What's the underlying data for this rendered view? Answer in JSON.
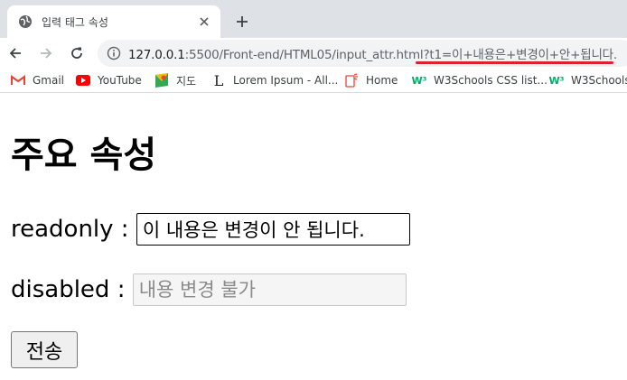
{
  "browser": {
    "tab": {
      "title": "입력 태그 속성"
    },
    "toolbar": {
      "url_host": "127.0.0.1",
      "url_path": ":5500/Front-end/HTML05/input_attr.html",
      "url_query": "?t1=이+내용은+변경이+안+됩니다."
    },
    "bookmarks": [
      {
        "label": "Gmail",
        "icon": "gmail-icon"
      },
      {
        "label": "YouTube",
        "icon": "youtube-icon"
      },
      {
        "label": "지도",
        "icon": "maps-icon"
      },
      {
        "label": "Lorem Ipsum - All...",
        "icon": "lorem-icon"
      },
      {
        "label": "Home",
        "icon": "home-icon"
      },
      {
        "label": "W3Schools CSS list...",
        "icon": "w3schools-icon"
      },
      {
        "label": "W3Schools",
        "icon": "w3schools-icon"
      }
    ]
  },
  "page": {
    "title": "주요 속성",
    "readonly_label": "readonly : ",
    "readonly_value": "이 내용은 변경이 안 됩니다.",
    "disabled_label": "disabled : ",
    "disabled_placeholder": "내용 변경 불가",
    "submit_label": "전송"
  },
  "colors": {
    "highlight_underline": "#d9232d",
    "tabstrip": "#dee1e6",
    "omnibox": "#f1f3f4"
  }
}
